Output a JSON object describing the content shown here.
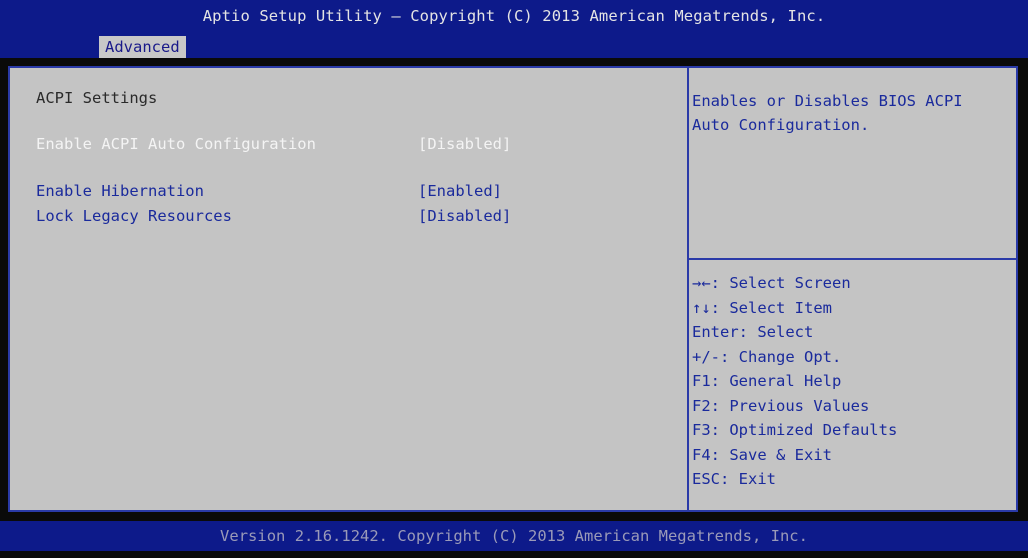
{
  "header": {
    "title": "Aptio Setup Utility – Copyright (C) 2013 American Megatrends, Inc.",
    "tab": "Advanced"
  },
  "main": {
    "section_title": "ACPI Settings",
    "settings": [
      {
        "label": "Enable ACPI Auto Configuration",
        "value": "[Disabled]",
        "selected": true
      },
      {
        "label": "Enable Hibernation",
        "value": "[Enabled]",
        "selected": false
      },
      {
        "label": "Lock Legacy Resources",
        "value": "[Disabled]",
        "selected": false
      }
    ]
  },
  "help": {
    "text_line1": "Enables or Disables BIOS ACPI",
    "text_line2": "Auto Configuration."
  },
  "keys": [
    {
      "key": "→←",
      "desc": ": Select Screen"
    },
    {
      "key": "↑↓",
      "desc": ": Select Item"
    },
    {
      "key": "Enter",
      "desc": ": Select"
    },
    {
      "key": "+/-",
      "desc": ": Change Opt."
    },
    {
      "key": "F1",
      "desc": ": General Help"
    },
    {
      "key": "F2",
      "desc": ": Previous Values"
    },
    {
      "key": "F3",
      "desc": ": Optimized Defaults"
    },
    {
      "key": "F4",
      "desc": ": Save & Exit"
    },
    {
      "key": "ESC",
      "desc": ": Exit"
    }
  ],
  "footer": {
    "version": "Version 2.16.1242. Copyright (C) 2013 American Megatrends, Inc."
  },
  "colors": {
    "header_bg": "#0d1a8a",
    "panel_bg": "#c4c4c4",
    "accent_text": "#1a2a9c",
    "selected_text": "#f4f4f4"
  }
}
